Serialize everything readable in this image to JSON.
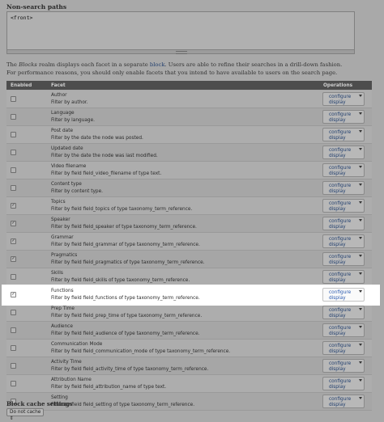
{
  "visibility": {
    "title": "Non-search paths",
    "textarea_value": "<front>"
  },
  "description": {
    "line1_prefix": "The ",
    "line1_realm": "Blocks",
    "line1_mid": " realm displays each facet in a separate ",
    "line1_link": "block",
    "line1_suffix": ". Users are able to refine their searches in a drill-down fashion.",
    "line2": "For performance reasons, you should only enable facets that you intend to have available to users on the search page."
  },
  "table": {
    "headers": {
      "enabled": "Enabled",
      "facet": "Facet",
      "operations": "Operations"
    },
    "configure_label": "configure",
    "display_label": "display",
    "rows": [
      {
        "name": "Author",
        "desc": "Filter by author.",
        "checked": false
      },
      {
        "name": "Language",
        "desc": "Filter by language.",
        "checked": false
      },
      {
        "name": "Post date",
        "desc": "Filter by the date the node was posted.",
        "checked": false
      },
      {
        "name": "Updated date",
        "desc": "Filter by the date the node was last modified.",
        "checked": false
      },
      {
        "name": "Video filename",
        "desc": "Filter by field field_video_filename of type text.",
        "checked": false
      },
      {
        "name": "Content type",
        "desc": "Filter by content type.",
        "checked": false
      },
      {
        "name": "Topics",
        "desc": "Filter by field field_topics of type taxonomy_term_reference.",
        "checked": true
      },
      {
        "name": "Speaker",
        "desc": "Filter by field field_speaker of type taxonomy_term_reference.",
        "checked": true
      },
      {
        "name": "Grammar",
        "desc": "Filter by field field_grammar of type taxonomy_term_reference.",
        "checked": true
      },
      {
        "name": "Pragmatics",
        "desc": "Filter by field field_pragmatics of type taxonomy_term_reference.",
        "checked": true
      },
      {
        "name": "Skills",
        "desc": "Filter by field field_skills of type taxonomy_term_reference.",
        "checked": false
      },
      {
        "name": "Functions",
        "desc": "Filter by field field_functions of type taxonomy_term_reference.",
        "checked": true,
        "highlighted": true
      },
      {
        "name": "Prep Time",
        "desc": "Filter by field field_prep_time of type taxonomy_term_reference.",
        "checked": false
      },
      {
        "name": "Audience",
        "desc": "Filter by field field_audience of type taxonomy_term_reference.",
        "checked": false
      },
      {
        "name": "Communication Mode",
        "desc": "Filter by field field_communication_mode of type taxonomy_term_reference.",
        "checked": false
      },
      {
        "name": "Activity Time",
        "desc": "Filter by field field_activity_time of type taxonomy_term_reference.",
        "checked": false
      },
      {
        "name": "Attribution Name",
        "desc": "Filter by field field_attribution_name of type text.",
        "checked": false
      },
      {
        "name": "Setting",
        "desc": "Filter by field field_setting of type taxonomy_term_reference.",
        "checked": false
      }
    ]
  },
  "block_cache": {
    "title": "Block cache settings",
    "selected": "Do not cache"
  },
  "icons": {
    "checkbox_checked": "checkmark-icon",
    "dropdown": "caret-down-icon"
  },
  "colors": {
    "overlay_bg": "#a9a9a9",
    "header_bg": "#4d4d4d",
    "highlight_bg": "#ffffff",
    "link": "#2b5bb0"
  }
}
